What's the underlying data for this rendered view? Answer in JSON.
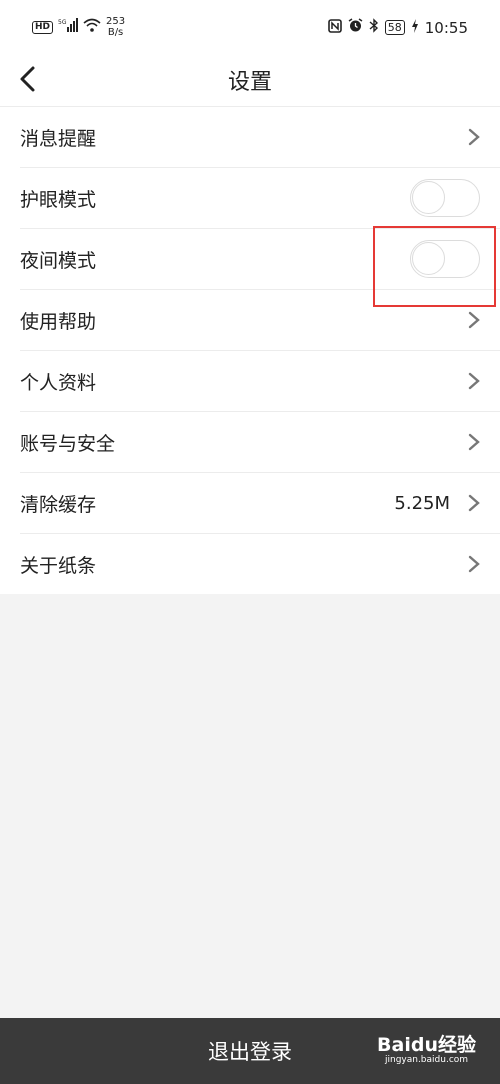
{
  "statusbar": {
    "left_badge": "HD",
    "net_type": "5G",
    "net_speed_value": "253",
    "net_speed_unit": "B/s",
    "battery": "58",
    "time": "10:55",
    "icons": [
      "signal-icon",
      "wifi-icon",
      "nfc-icon",
      "alarm-icon",
      "bluetooth-icon",
      "battery-icon",
      "charging-icon"
    ]
  },
  "header": {
    "title": "设置"
  },
  "settings": {
    "items": [
      {
        "label": "消息提醒",
        "control": "chevron"
      },
      {
        "label": "护眼模式",
        "control": "toggle",
        "on": false
      },
      {
        "label": "夜间模式",
        "control": "toggle",
        "on": false
      },
      {
        "label": "使用帮助",
        "control": "chevron"
      },
      {
        "label": "个人资料",
        "control": "chevron"
      },
      {
        "label": "账号与安全",
        "control": "chevron"
      },
      {
        "label": "清除缓存",
        "control": "chevron",
        "value": "5.25M"
      },
      {
        "label": "关于纸条",
        "control": "chevron"
      }
    ]
  },
  "footer": {
    "logout_label": "退出登录"
  },
  "watermark": {
    "logo": "Baidu经验",
    "url": "jingyan.baidu.com"
  },
  "colors": {
    "highlight": "#e53935",
    "footer_bg": "#3a3a3a",
    "page_bg": "#f3f3f3"
  }
}
